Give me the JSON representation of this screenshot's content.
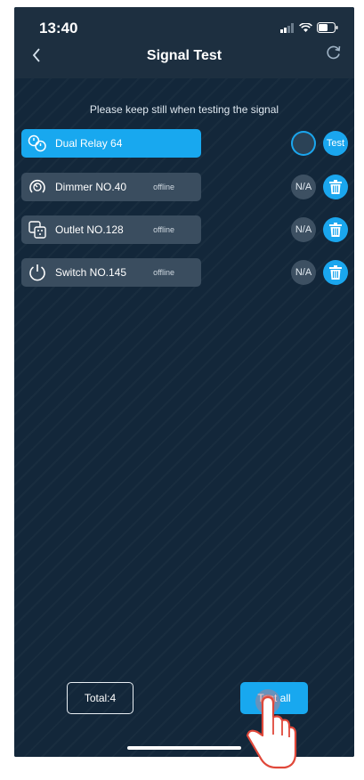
{
  "status_bar": {
    "time": "13:40"
  },
  "nav": {
    "back_icon": "chevron-left-icon",
    "title": "Signal Test",
    "refresh_icon": "refresh-icon"
  },
  "hint": "Please keep still when testing the signal",
  "devices": [
    {
      "name": "Dual Relay 64",
      "status": "",
      "icon": "dual-relay-icon",
      "action_left": "",
      "action_right": "Test",
      "active": true
    },
    {
      "name": "Dimmer NO.40",
      "status": "offline",
      "icon": "dimmer-icon",
      "action_left": "N/A",
      "action_right": "trash-icon",
      "active": false
    },
    {
      "name": "Outlet NO.128",
      "status": "offline",
      "icon": "outlet-icon",
      "action_left": "N/A",
      "action_right": "trash-icon",
      "active": false
    },
    {
      "name": "Switch NO.145",
      "status": "offline",
      "icon": "power-icon",
      "action_left": "N/A",
      "action_right": "trash-icon",
      "active": false
    }
  ],
  "footer": {
    "total_label": "Total:4",
    "test_all_label": "Test all"
  },
  "colors": {
    "accent": "#18a8ef",
    "background": "#13273a",
    "row": "#3a4d5f"
  }
}
